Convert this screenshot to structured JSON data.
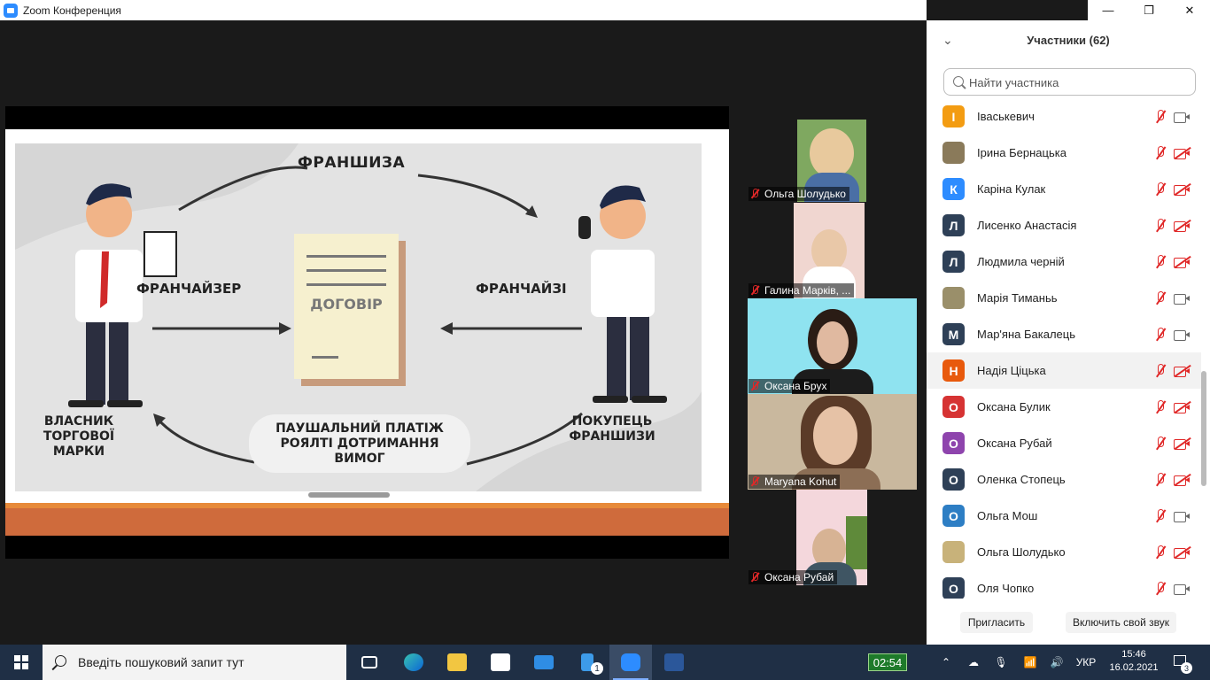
{
  "window": {
    "title": "Zoom Конференция",
    "minimize": "—",
    "restore": "❐",
    "close": "✕"
  },
  "slide": {
    "title": "ФРАНШИЗА",
    "franchisor": "ФРАНЧАЙЗЕР",
    "franchisee": "ФРАНЧАЙЗІ",
    "document": "ДОГОВІР",
    "owner": "ВЛАСНИК ТОРГОВОЇ МАРКИ",
    "buyer": "ПОКУПЕЦЬ ФРАНШИЗИ",
    "payment": "ПАУШАЛЬНИЙ ПЛАТІЖ РОЯЛТІ ДОТРИМАННЯ ВИМОГ"
  },
  "videos": [
    {
      "name": "Ольга Шолудько"
    },
    {
      "name": "Галина Марків, ..."
    },
    {
      "name": "Оксана Брух"
    },
    {
      "name": "Maryana Kohut"
    },
    {
      "name": "Оксана Рубай"
    }
  ],
  "panel": {
    "title": "Участники (62)",
    "search_placeholder": "Найти участника",
    "invite": "Пригласить",
    "unmute": "Включить свой звук"
  },
  "participants": [
    {
      "name": "Іваськевич",
      "initial": "І",
      "color": "#f39c12",
      "cam_off": false
    },
    {
      "name": "Ірина Бернацька",
      "initial": "",
      "color": "#8a7a5a",
      "cam_off": true
    },
    {
      "name": "Каріна Кулак",
      "initial": "К",
      "color": "#2d8cff",
      "cam_off": true
    },
    {
      "name": "Лисенко Анастасія",
      "initial": "Л",
      "color": "#2e4057",
      "cam_off": true
    },
    {
      "name": "Людмила черній",
      "initial": "Л",
      "color": "#2e4057",
      "cam_off": true
    },
    {
      "name": "Марія Тиманьь",
      "initial": "",
      "color": "#9a8f6a",
      "cam_off": false
    },
    {
      "name": "Мар'яна Бакалець",
      "initial": "М",
      "color": "#2e4057",
      "cam_off": false
    },
    {
      "name": "Надія Ціцька",
      "initial": "Н",
      "color": "#e8590c",
      "cam_off": true
    },
    {
      "name": "Оксана Булик",
      "initial": "О",
      "color": "#d63333",
      "cam_off": true
    },
    {
      "name": "Оксана Рубай",
      "initial": "О",
      "color": "#8e44ad",
      "cam_off": true
    },
    {
      "name": "Оленка Стопець",
      "initial": "О",
      "color": "#2e4057",
      "cam_off": true
    },
    {
      "name": "Ольга Мош",
      "initial": "О",
      "color": "#2d7ec4",
      "cam_off": false
    },
    {
      "name": "Ольга Шолудько",
      "initial": "",
      "color": "#c8b27a",
      "cam_off": true
    },
    {
      "name": "Оля Чопко",
      "initial": "О",
      "color": "#2e4057",
      "cam_off": false
    }
  ],
  "taskbar": {
    "search_placeholder": "Введіть пошуковий запит тут",
    "timer": "02:54",
    "lang": "УКР",
    "time": "15:46",
    "date": "16.02.2021",
    "notifications": "3",
    "badge_count": "1"
  }
}
